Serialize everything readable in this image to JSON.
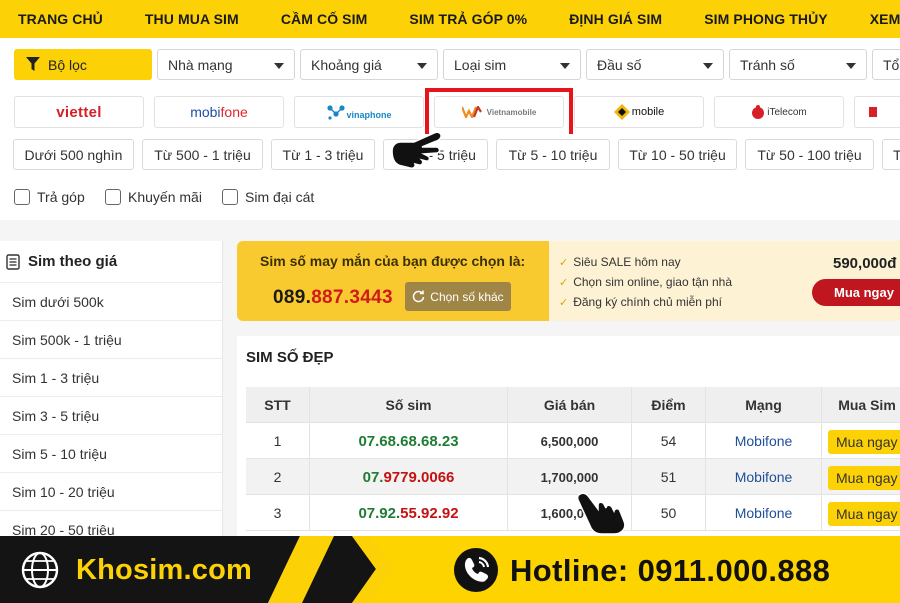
{
  "nav": {
    "items": [
      "TRANG CHỦ",
      "THU MUA SIM",
      "CẦM CỐ SIM",
      "SIM TRẢ GÓP 0%",
      "ĐỊNH GIÁ SIM",
      "SIM PHONG THỦY",
      "XEM K"
    ]
  },
  "filters": {
    "filter_button": "Bộ lọc",
    "selects": [
      "Nhà mạng",
      "Khoảng giá",
      "Loại sim",
      "Đầu số",
      "Tránh số",
      "Tổ"
    ]
  },
  "carriers": {
    "viettel": "viettel",
    "mobifone_a": "mobi",
    "mobifone_b": "fone",
    "vinaphone": "vinaphone",
    "vietnamobile": "Vietnamobile",
    "gmobile": "mobile",
    "itel": "iTelecom"
  },
  "price_ranges": [
    "Dưới 500 nghìn",
    "Từ 500 - 1 triệu",
    "Từ 1 - 3 triệu",
    "Từ 3 - 5 triệu",
    "Từ 5 - 10 triệu",
    "Từ 10 - 50 triệu",
    "Từ 50 - 100 triệu",
    "T"
  ],
  "checkboxes": [
    "Trả góp",
    "Khuyến mãi",
    "Sim đại cát"
  ],
  "sidebar": {
    "title": "Sim theo giá",
    "items": [
      "Sim dưới 500k",
      "Sim 500k - 1 triệu",
      "Sim 1 - 3 triệu",
      "Sim 3 - 5 triệu",
      "Sim 5 - 10 triệu",
      "Sim 10 - 20 triệu",
      "Sim 20 - 50 triệu"
    ]
  },
  "lucky": {
    "title": "Sim số may mắn của bạn được chọn là:",
    "number_prefix": "089.",
    "number_suffix": "887.3443",
    "choose_button": "Chọn số khác"
  },
  "promo": {
    "lines": [
      "Siêu SALE hôm nay",
      "Chọn sim online, giao tận nhà",
      "Đăng ký chính chủ miễn phí"
    ],
    "price": "590,000đ",
    "buy_button": "Mua ngay"
  },
  "table": {
    "title": "SIM SỐ ĐẸP",
    "headers": [
      "STT",
      "Số sim",
      "Giá bán",
      "Điểm",
      "Mạng",
      "Mua Sim"
    ],
    "rows": [
      {
        "stt": "1",
        "sim_parts": [
          "07.",
          "68.68.68.",
          "23"
        ],
        "price": "6,500,000",
        "points": "54",
        "network": "Mobifone",
        "buy": "Mua ngay"
      },
      {
        "stt": "2",
        "sim_parts": [
          "07.",
          "9779.0066",
          ""
        ],
        "price": "1,700,000",
        "points": "51",
        "network": "Mobifone",
        "buy": "Mua ngay"
      },
      {
        "stt": "3",
        "sim_parts": [
          "07.",
          "92.",
          "55.92.92"
        ],
        "price": "1,600,000",
        "points": "50",
        "network": "Mobifone",
        "buy": "Mua ngay"
      }
    ]
  },
  "footer": {
    "brand": "Khosim.com",
    "hotline": "Hotline: 0911.000.888"
  },
  "colors": {
    "accent_yellow": "#fcd206",
    "highlight_red": "#e8141c",
    "buy_red": "#c01620",
    "sim_green": "#1e7c33",
    "sim_red": "#c41212"
  }
}
